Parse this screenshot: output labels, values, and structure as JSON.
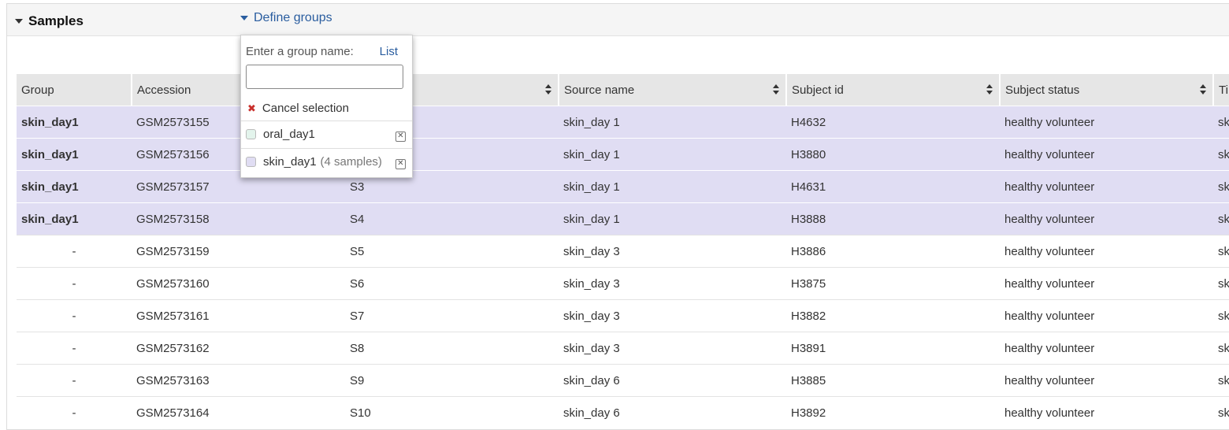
{
  "panel": {
    "title": "Samples",
    "define_groups_label": "Define groups"
  },
  "popup": {
    "prompt": "Enter a group name:",
    "list_link": "List",
    "input_value": "",
    "input_placeholder": "",
    "cancel_label": "Cancel selection",
    "groups": [
      {
        "name": "oral_day1",
        "count_label": "",
        "color": "#e3f4ec"
      },
      {
        "name": "skin_day1",
        "count_label": "(4 samples)",
        "color": "#e0ddf3"
      }
    ]
  },
  "colors": {
    "group_highlight": "#e0ddf3",
    "link": "#2a5d9f",
    "header_bg": "#e6e6e6",
    "cancel_red": "#c9302c"
  },
  "table": {
    "columns": [
      "Group",
      "Accession",
      "",
      "Source name",
      "Subject id",
      "Subject status",
      "Ti"
    ],
    "rows": [
      {
        "group": "skin_day1",
        "accession": "GSM2573155",
        "title": "",
        "source": "skin_day 1",
        "subject_id": "H4632",
        "status": "healthy volunteer",
        "tissue": "sk"
      },
      {
        "group": "skin_day1",
        "accession": "GSM2573156",
        "title": "",
        "source": "skin_day 1",
        "subject_id": "H3880",
        "status": "healthy volunteer",
        "tissue": "sk"
      },
      {
        "group": "skin_day1",
        "accession": "GSM2573157",
        "title": "S3",
        "source": "skin_day 1",
        "subject_id": "H4631",
        "status": "healthy volunteer",
        "tissue": "sk"
      },
      {
        "group": "skin_day1",
        "accession": "GSM2573158",
        "title": "S4",
        "source": "skin_day 1",
        "subject_id": "H3888",
        "status": "healthy volunteer",
        "tissue": "sk"
      },
      {
        "group": "-",
        "accession": "GSM2573159",
        "title": "S5",
        "source": "skin_day 3",
        "subject_id": "H3886",
        "status": "healthy volunteer",
        "tissue": "sk"
      },
      {
        "group": "-",
        "accession": "GSM2573160",
        "title": "S6",
        "source": "skin_day 3",
        "subject_id": "H3875",
        "status": "healthy volunteer",
        "tissue": "sk"
      },
      {
        "group": "-",
        "accession": "GSM2573161",
        "title": "S7",
        "source": "skin_day 3",
        "subject_id": "H3882",
        "status": "healthy volunteer",
        "tissue": "sk"
      },
      {
        "group": "-",
        "accession": "GSM2573162",
        "title": "S8",
        "source": "skin_day 3",
        "subject_id": "H3891",
        "status": "healthy volunteer",
        "tissue": "sk"
      },
      {
        "group": "-",
        "accession": "GSM2573163",
        "title": "S9",
        "source": "skin_day 6",
        "subject_id": "H3885",
        "status": "healthy volunteer",
        "tissue": "sk"
      },
      {
        "group": "-",
        "accession": "GSM2573164",
        "title": "S10",
        "source": "skin_day 6",
        "subject_id": "H3892",
        "status": "healthy volunteer",
        "tissue": "sk"
      }
    ]
  }
}
